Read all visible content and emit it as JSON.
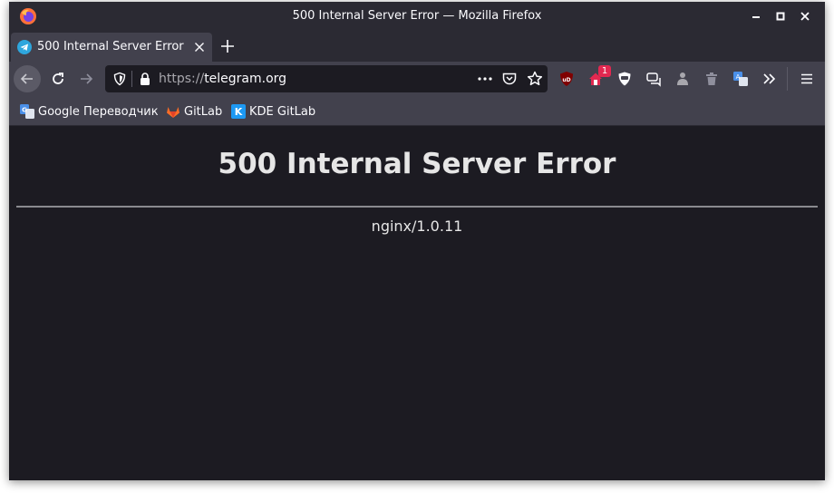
{
  "window": {
    "title": "500 Internal Server Error — Mozilla Firefox"
  },
  "tab": {
    "label": "500 Internal Server Error"
  },
  "url": {
    "protocol": "https://",
    "host": "telegram.org"
  },
  "toolbar": {
    "badge_count": "1"
  },
  "bookmarks": [
    {
      "label": "Google Переводчик",
      "icon": "google-translate-icon"
    },
    {
      "label": "GitLab",
      "icon": "gitlab-icon"
    },
    {
      "label": "KDE GitLab",
      "icon": "kde-icon"
    }
  ],
  "page": {
    "heading": "500 Internal Server Error",
    "server": "nginx/1.0.11"
  },
  "colors": {
    "chrome": "#2b2a33",
    "toolbar": "#42414d",
    "content_bg": "#1c1b22",
    "text": "#fbfbfe",
    "ublock_red": "#800000"
  }
}
